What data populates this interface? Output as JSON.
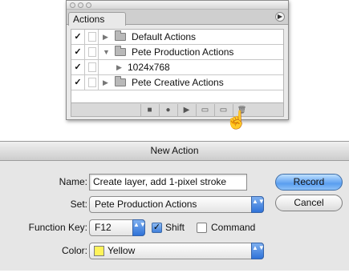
{
  "actions_panel": {
    "tab_label": "Actions",
    "menu_icon": "panel-menu-arrow",
    "rows": [
      {
        "check": "✓",
        "expand": "▶",
        "label": "Default Actions",
        "icon": "folder-icon"
      },
      {
        "check": "✓",
        "expand": "▼",
        "label": "Pete Production Actions",
        "icon": "folder-icon"
      },
      {
        "check": "✓",
        "expand": "▶",
        "label": "1024x768",
        "icon": ""
      },
      {
        "check": "✓",
        "expand": "▶",
        "label": "Pete Creative Actions",
        "icon": "folder-icon"
      }
    ],
    "bottom_buttons": {
      "stop": "■",
      "record": "●",
      "play": "▶",
      "new_set": "▭",
      "new_action": "▭",
      "delete": "🗑"
    },
    "cursor": "☝"
  },
  "dialog": {
    "title": "New Action",
    "name_label": "Name:",
    "name_value": "Create layer, add 1-pixel stroke",
    "set_label": "Set:",
    "set_value": "Pete Production Actions",
    "function_key_label": "Function Key:",
    "function_key_value": "F12",
    "shift_label": "Shift",
    "shift_checked": true,
    "command_label": "Command",
    "command_checked": false,
    "color_label": "Color:",
    "color_value": "Yellow",
    "color_swatch": "#fff35a",
    "record_label": "Record",
    "cancel_label": "Cancel",
    "popup_arrows": "▲▼",
    "checkmark": "✓"
  }
}
